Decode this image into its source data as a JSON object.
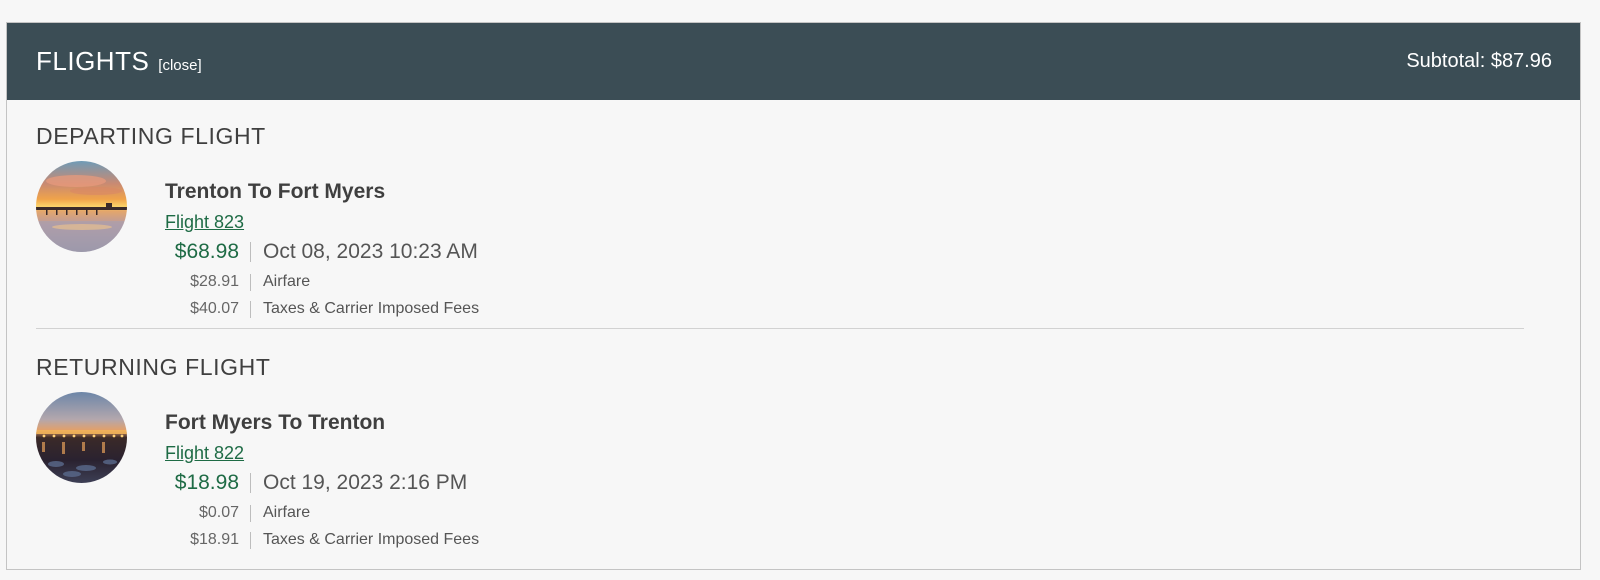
{
  "header": {
    "title": "FLIGHTS",
    "close_label": "[close]",
    "subtotal": "Subtotal: $87.96"
  },
  "departing": {
    "section_title": "DEPARTING  FLIGHT",
    "image": "sunset-pier-photo",
    "route": "Trenton To Fort Myers",
    "flight_link": "Flight 823",
    "total": "$68.98",
    "datetime": "Oct 08, 2023 10:23 AM",
    "breakdown": [
      {
        "amount": "$28.91",
        "label": "Airfare"
      },
      {
        "amount": "$40.07",
        "label": "Taxes & Carrier Imposed Fees"
      }
    ]
  },
  "returning": {
    "section_title": "RETURNING  FLIGHT",
    "image": "night-bridge-photo",
    "route": "Fort Myers To Trenton",
    "flight_link": "Flight 822",
    "total": "$18.98",
    "datetime": "Oct 19, 2023 2:16 PM",
    "breakdown": [
      {
        "amount": "$0.07",
        "label": "Airfare"
      },
      {
        "amount": "$18.91",
        "label": "Taxes & Carrier Imposed Fees"
      }
    ]
  },
  "colors": {
    "header_bg": "#3b4d55",
    "price_green": "#1e6b45",
    "page_bg": "#f7f7f7"
  }
}
